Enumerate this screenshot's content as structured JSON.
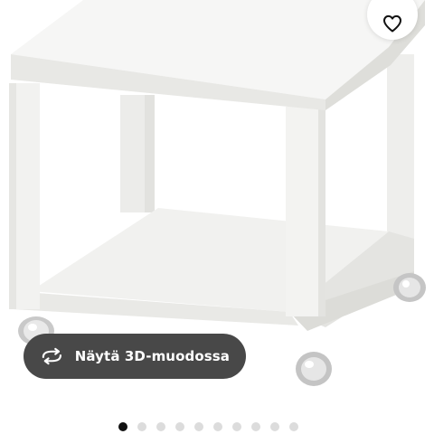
{
  "product": {
    "image_icon": "side-table-on-castors-image"
  },
  "favourite": {
    "icon": "heart-outline-icon"
  },
  "view3d": {
    "icon": "rotate-arrows-icon",
    "label": "Näytä 3D-muodossa"
  },
  "gallery": {
    "count": 10,
    "active_index": 0
  },
  "colors": {
    "button_dark": "#484848",
    "dot_active": "#111111",
    "dot_inactive": "#dcdcdc"
  }
}
